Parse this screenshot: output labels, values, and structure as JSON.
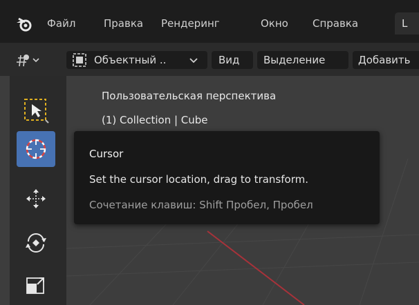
{
  "menubar": {
    "logo": "blender-logo-icon",
    "items": [
      "Файл",
      "Правка",
      "Рендеринг",
      "Окно",
      "Справка"
    ],
    "workspace_tab": "L"
  },
  "toolbar": {
    "editor_type_icon": "3d-viewport-editor-icon",
    "mode_icon": "object-mode-icon",
    "mode_label": "Объектный ..",
    "view_label": "Вид",
    "select_label": "Выделение",
    "add_label": "Добавить"
  },
  "viewport": {
    "perspective_label": "Пользовательская перспектива",
    "collection_label": "(1) Collection | Cube"
  },
  "tools": [
    {
      "name": "select-box-tool",
      "icon": "select-box-icon",
      "active": false
    },
    {
      "name": "cursor-tool",
      "icon": "cursor-icon",
      "active": true
    },
    {
      "name": "move-tool",
      "icon": "move-icon",
      "active": false
    },
    {
      "name": "rotate-tool",
      "icon": "rotate-icon",
      "active": false
    },
    {
      "name": "scale-tool",
      "icon": "scale-icon",
      "active": false
    }
  ],
  "tooltip": {
    "title": "Cursor",
    "description": "Set the cursor location, drag to transform.",
    "shortcut": "Сочетание клавиш: Shift Пробел, Пробел"
  },
  "colors": {
    "active_tool": "#4772b3",
    "x_axis": "#a8323a",
    "viewport_bg": "#3d3d3d"
  }
}
